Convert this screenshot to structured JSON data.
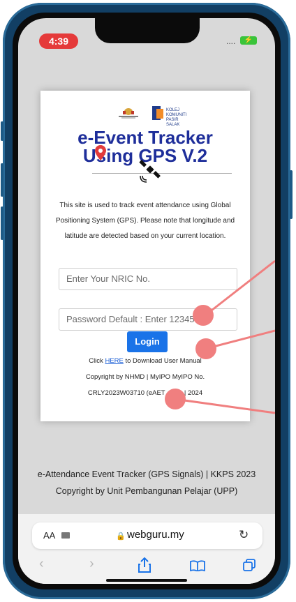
{
  "status": {
    "time": "4:39",
    "signal": "....",
    "battery": "⚡"
  },
  "page": {
    "title_line1": "e-Event Tracker",
    "title_line2": "Using GPS V.2",
    "description": "This site is used to track event attendance using Global Positioning System (GPS). Please note that longitude and latitude are detected based on your current location.",
    "nric_placeholder": "Enter Your NRIC No.",
    "password_placeholder": "Password Default : Enter 12345",
    "login_label": "Login",
    "manual_prefix": "Click ",
    "manual_link": "HERE",
    "manual_suffix": " to Download User Manual",
    "copyright_line1": "Copyright by NHMD | MyIPO MyIPO No.",
    "copyright_line2": "CRLY2023W03710 (eAET - 2.1) | 2024"
  },
  "footer": {
    "line1": "e-Attendance Event Tracker (GPS Signals) | KKPS 2023",
    "line2": "Copyright by Unit Pembangunan Pelajar (UPP)"
  },
  "browser": {
    "aa": "AA",
    "url": "webguru.my",
    "icons": [
      "back-icon",
      "forward-icon",
      "share-icon",
      "bookmarks-icon",
      "tabs-icon",
      "reload-icon",
      "lock-icon"
    ]
  },
  "colors": {
    "title": "#1e2e9a",
    "login_button": "#1a73e8",
    "annotation_dot": "#f07f7f",
    "frame": "#123f64"
  }
}
